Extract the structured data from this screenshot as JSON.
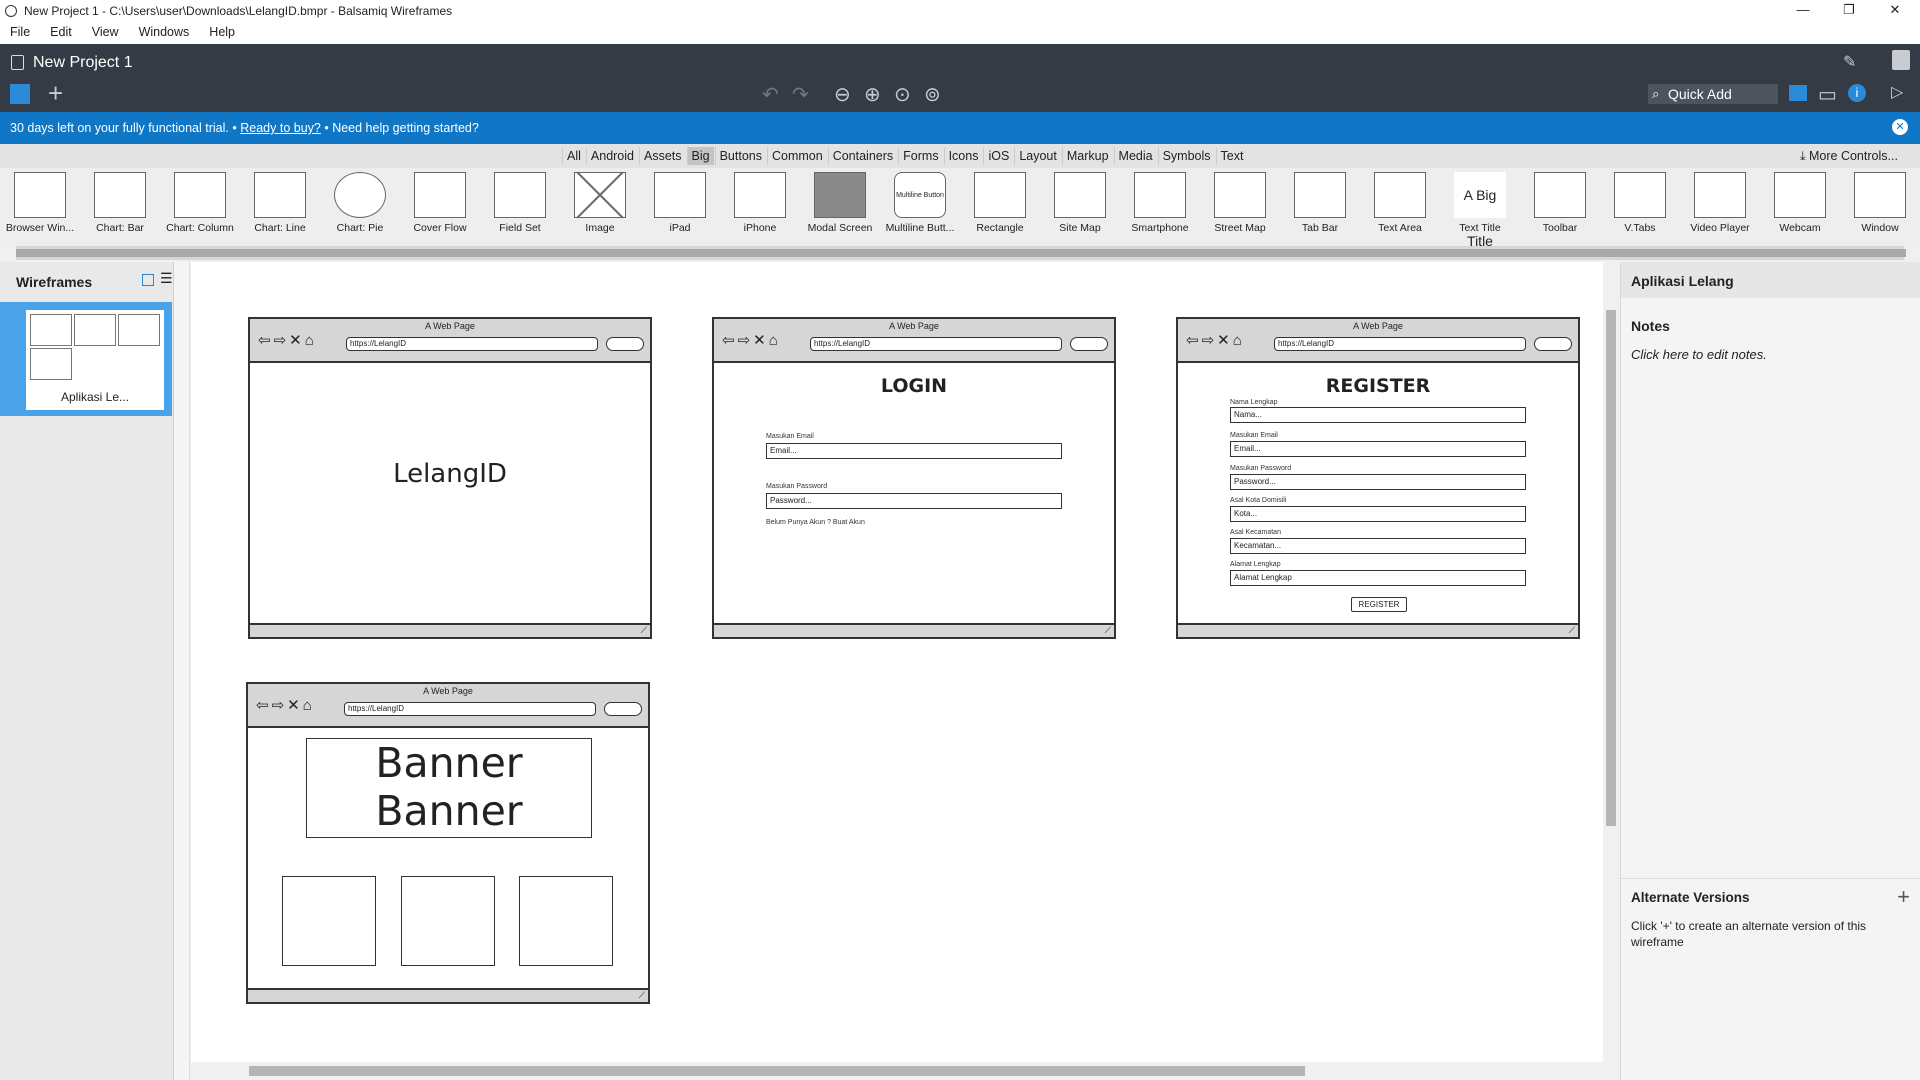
{
  "window": {
    "title": "New Project 1 - C:\\Users\\user\\Downloads\\LelangID.bmpr - Balsamiq Wireframes",
    "minimize": "—",
    "restore": "❐",
    "close": "✕"
  },
  "menu": [
    "File",
    "Edit",
    "View",
    "Windows",
    "Help"
  ],
  "header": {
    "project_title": "New Project 1",
    "quick_add": "Quick Add"
  },
  "trial": {
    "days_left": "30 days left on your fully functional trial.",
    "sep1": "•",
    "buy_link": "Ready to buy?",
    "sep2": "•",
    "help": "Need help getting started?"
  },
  "categories": [
    "All",
    "Android",
    "Assets",
    "Big",
    "Buttons",
    "Common",
    "Containers",
    "Forms",
    "Icons",
    "iOS",
    "Layout",
    "Markup",
    "Media",
    "Symbols",
    "Text"
  ],
  "active_category": "Big",
  "more_controls": "More Controls...",
  "library": [
    "Browser Win...",
    "Chart: Bar",
    "Chart: Column",
    "Chart: Line",
    "Chart: Pie",
    "Cover Flow",
    "Field Set",
    "Image",
    "iPad",
    "iPhone",
    "Modal Screen",
    "Multiline Butt...",
    "Rectangle",
    "Site Map",
    "Smartphone",
    "Street Map",
    "Tab Bar",
    "Text Area",
    "Text Title",
    "Toolbar",
    "V.Tabs",
    "Video Player",
    "Webcam",
    "Window"
  ],
  "library_text_title": "A Big Title",
  "library_multiline": "Multiline Button",
  "left_panel": {
    "title": "Wireframes",
    "thumb_label": "Aplikasi Le..."
  },
  "right_panel": {
    "title": "Aplikasi Lelang",
    "notes_label": "Notes",
    "notes_placeholder": "Click here to edit notes.",
    "alt_versions": "Alternate Versions",
    "alt_desc": "Click '+' to create an alternate version of this wireframe"
  },
  "mockups": {
    "browser_title": "A Web Page",
    "url": "https://LelangID",
    "home": {
      "heading": "LelangID"
    },
    "login": {
      "heading": "LOGIN",
      "email_label": "Masukan Email",
      "email_value": "Email...",
      "password_label": "Masukan Password",
      "password_value": "Password...",
      "footer": "Belum Punya Akun ? Buat Akun"
    },
    "register": {
      "heading": "REGISTER",
      "fields": [
        {
          "label": "Nama Lengkap",
          "value": "Nama..."
        },
        {
          "label": "Masukan Email",
          "value": "Email..."
        },
        {
          "label": "Masukan Password",
          "value": "Password..."
        },
        {
          "label": "Asal Kota Domisili",
          "value": "Kota..."
        },
        {
          "label": "Asal Kecamatan",
          "value": "Kecamatan..."
        },
        {
          "label": "Alamat Lengkap",
          "value": "Alamat Lengkap"
        }
      ],
      "button": "REGISTER"
    },
    "banner": {
      "line1": "Banner",
      "line2": "Banner"
    }
  }
}
